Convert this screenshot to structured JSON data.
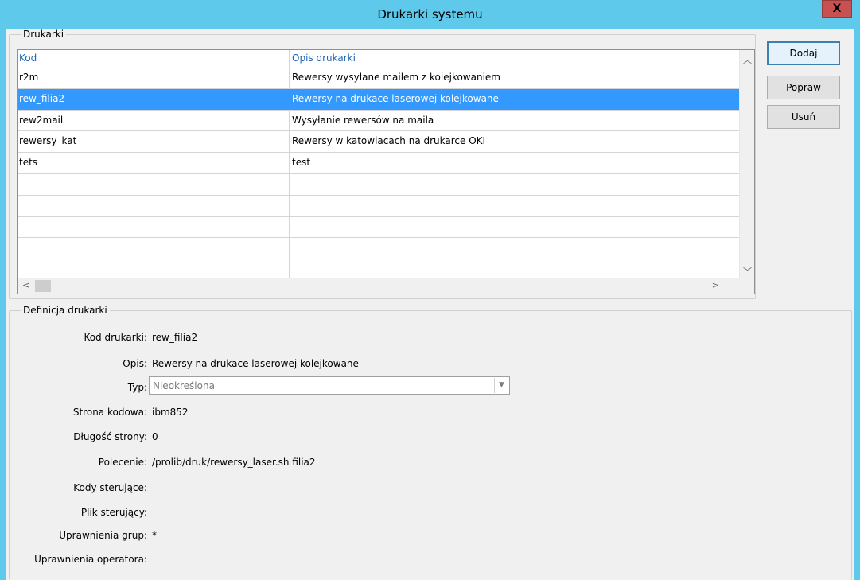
{
  "window": {
    "title": "Drukarki systemu",
    "close_label": "X"
  },
  "printers_group": {
    "legend": "Drukarki",
    "columns": {
      "kod": "Kod",
      "opis": "Opis drukarki"
    },
    "rows": [
      {
        "kod": "r2m",
        "opis": "Rewersy wysyłane mailem z kolejkowaniem"
      },
      {
        "kod": "rew_filia2",
        "opis": "Rewersy na drukace laserowej kolejkowane"
      },
      {
        "kod": "rew2mail",
        "opis": "Wysyłanie rewersów na maila"
      },
      {
        "kod": "rewersy_kat",
        "opis": "Rewersy w katowiacach na drukarce OKI"
      },
      {
        "kod": "tets",
        "opis": "test"
      }
    ],
    "selected_index": 1
  },
  "buttons": {
    "add": "Dodaj",
    "edit": "Popraw",
    "remove": "Usuń"
  },
  "definition_group": {
    "legend": "Definicja drukarki",
    "kod_label": "Kod drukarki:",
    "kod_value": "rew_filia2",
    "opis_label": "Opis:",
    "opis_value": "Rewersy na drukace laserowej kolejkowane",
    "typ_label": "Typ:",
    "typ_value": "Nieokreślona",
    "codepage_label": "Strona kodowa:",
    "codepage_value": "ibm852",
    "pagelen_label": "Długość strony:",
    "pagelen_value": "0",
    "command_label": "Polecenie:",
    "command_value": "/prolib/druk/rewersy_laser.sh filia2",
    "ctrlcodes_label": "Kody sterujące:",
    "ctrlcodes_value": "",
    "ctrlfile_label": "Plik sterujący:",
    "ctrlfile_value": "",
    "groupperm_label": "Uprawnienia grup:",
    "groupperm_value": "*",
    "operperm_label": "Uprawnienia operatora:",
    "operperm_value": ""
  },
  "colors": {
    "titlebar": "#5fc9ec",
    "selection": "#3399ff",
    "header_text": "#1e64b4"
  }
}
